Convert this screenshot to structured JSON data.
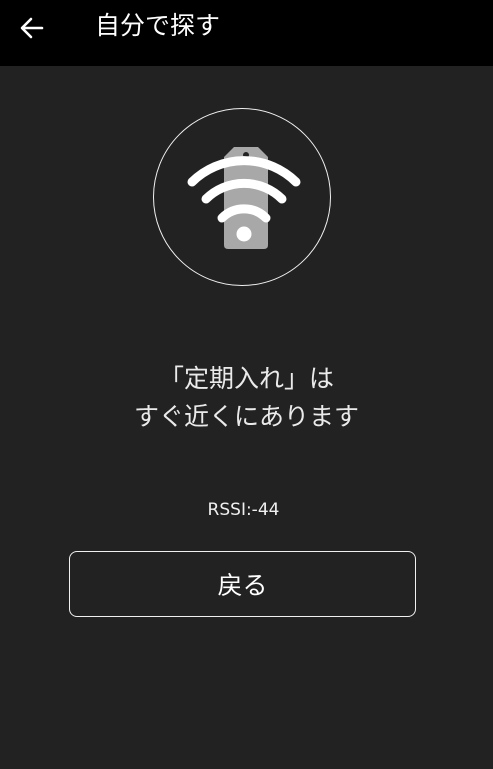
{
  "header": {
    "title": "自分で探す",
    "back_icon": "arrow-left-icon"
  },
  "tag_icon": "tag-signal-icon",
  "message": {
    "line1": "「定期入れ」は",
    "line2": "すぐ近くにあります"
  },
  "rssi": "RSSI:-44",
  "return_button": "戻る",
  "colors": {
    "appbar": "#000000",
    "background": "#222222",
    "icon_gray": "#a8a8a8",
    "foreground": "#ffffff"
  }
}
